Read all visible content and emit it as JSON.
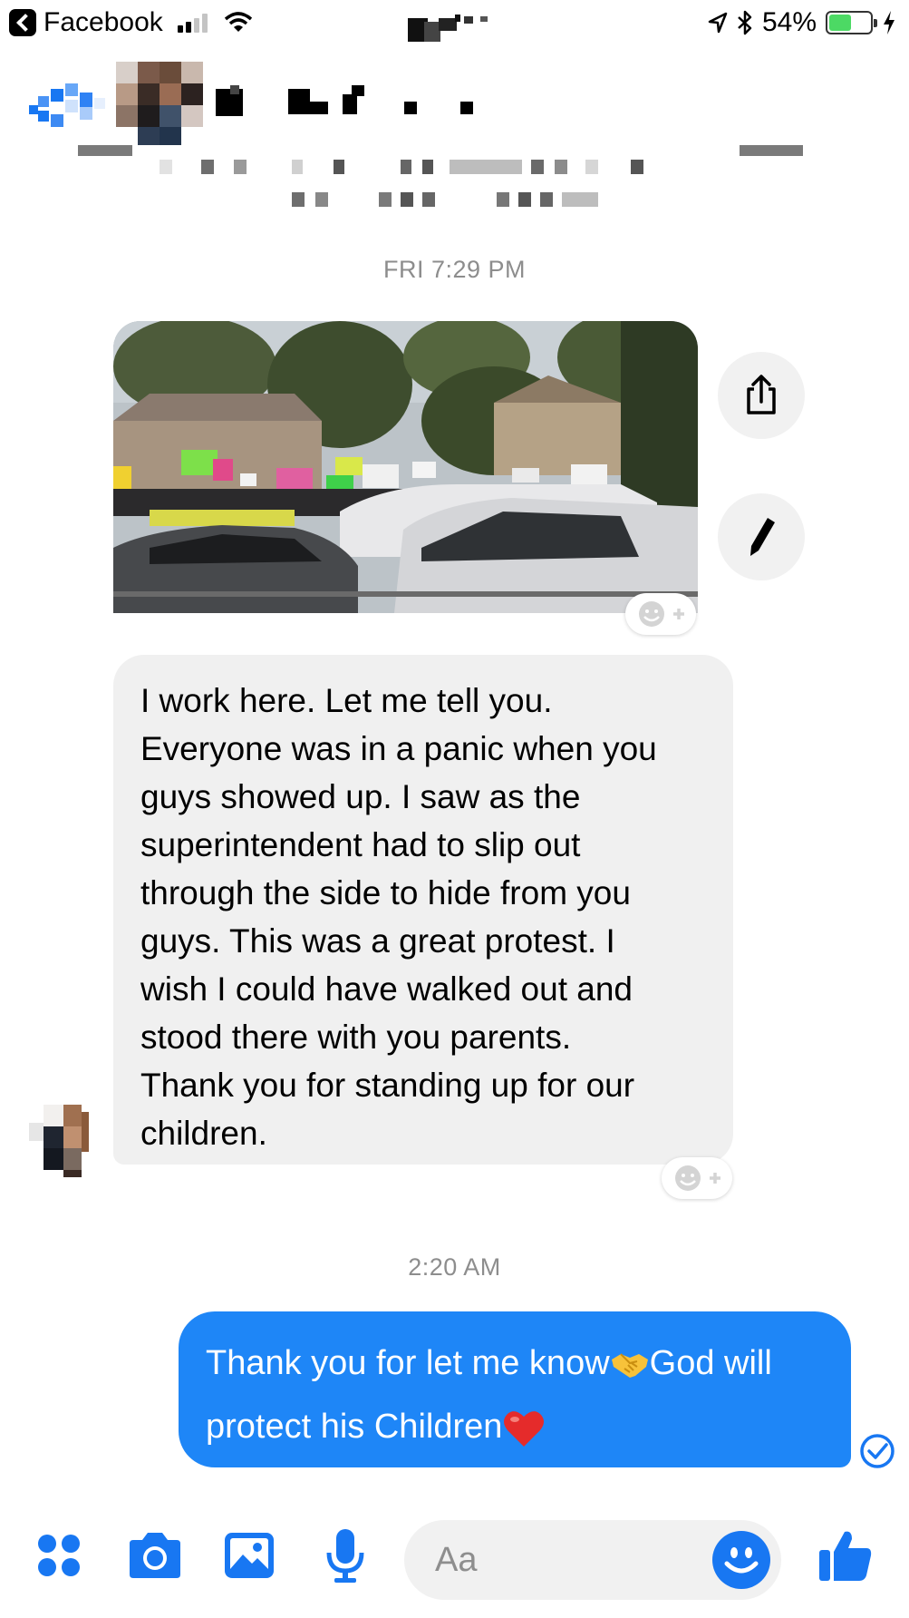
{
  "status_bar": {
    "app_back_label": "Facebook",
    "battery_percent": "54%",
    "battery_level": 0.54,
    "signal_bars": 2
  },
  "conversation": {
    "timestamp_1": "FRI 7:29 PM",
    "incoming_message_lines": [
      "I work here.  Let me tell you.",
      "Everyone was in a panic when you",
      "guys showed up.  I saw as the",
      "superintendent had to slip out",
      "through the side to hide from you",
      "guys.  This was a great protest. I",
      "wish I could have walked out and",
      "stood there with you parents.",
      "Thank you for standing up for our",
      "children."
    ],
    "timestamp_2": "2:20 AM",
    "outgoing_message": {
      "line1_a": "Thank you for let me know",
      "line1_b": "God will",
      "line2": "protect his Children"
    }
  },
  "composer": {
    "placeholder": "Aa"
  },
  "icons": {
    "photo_actions": [
      "share-icon",
      "edit-icon"
    ],
    "composer": [
      "more-apps-icon",
      "camera-icon",
      "gallery-icon",
      "microphone-icon",
      "emoji-icon",
      "thumbs-up-icon"
    ]
  },
  "colors": {
    "accent": "#1877f2",
    "outgoing_bubble": "#1e86f7",
    "incoming_bubble": "#f0f0f0",
    "timestamp_text": "#8d8d8d",
    "battery_fill": "#4cd964"
  }
}
